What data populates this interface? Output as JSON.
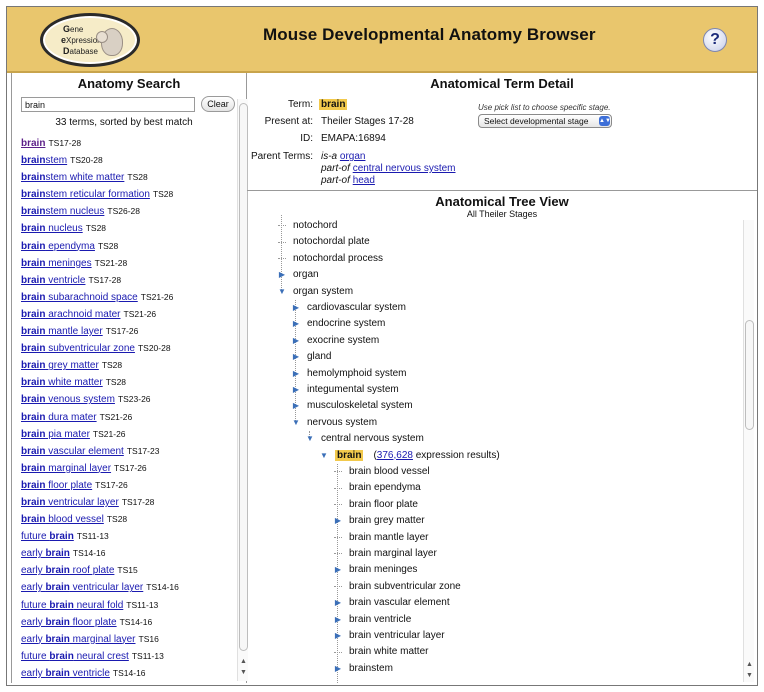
{
  "header": {
    "logo_lines": [
      "Gene",
      "eXpression",
      "Database"
    ],
    "title": "Mouse Developmental Anatomy Browser",
    "help_label": "?"
  },
  "search": {
    "title": "Anatomy Search",
    "query": "brain",
    "clear_label": "Clear",
    "count_text": "33 terms, sorted by best match",
    "results": [
      {
        "pre": "",
        "hl": "brain",
        "post": "",
        "ts": "TS17-28",
        "visited": true
      },
      {
        "pre": "",
        "hl": "brain",
        "post": "stem",
        "ts": "TS20-28"
      },
      {
        "pre": "",
        "hl": "brain",
        "post": "stem white matter",
        "ts": "TS28"
      },
      {
        "pre": "",
        "hl": "brain",
        "post": "stem reticular formation",
        "ts": "TS28"
      },
      {
        "pre": "",
        "hl": "brain",
        "post": "stem nucleus",
        "ts": "TS26-28"
      },
      {
        "pre": "",
        "hl": "brain",
        "post": " nucleus",
        "ts": "TS28"
      },
      {
        "pre": "",
        "hl": "brain",
        "post": " ependyma",
        "ts": "TS28"
      },
      {
        "pre": "",
        "hl": "brain",
        "post": " meninges",
        "ts": "TS21-28"
      },
      {
        "pre": "",
        "hl": "brain",
        "post": " ventricle",
        "ts": "TS17-28"
      },
      {
        "pre": "",
        "hl": "brain",
        "post": " subarachnoid space",
        "ts": "TS21-26"
      },
      {
        "pre": "",
        "hl": "brain",
        "post": " arachnoid mater",
        "ts": "TS21-26"
      },
      {
        "pre": "",
        "hl": "brain",
        "post": " mantle layer",
        "ts": "TS17-26"
      },
      {
        "pre": "",
        "hl": "brain",
        "post": " subventricular zone",
        "ts": "TS20-28"
      },
      {
        "pre": "",
        "hl": "brain",
        "post": " grey matter",
        "ts": "TS28"
      },
      {
        "pre": "",
        "hl": "brain",
        "post": " white matter",
        "ts": "TS28"
      },
      {
        "pre": "",
        "hl": "brain",
        "post": " venous system",
        "ts": "TS23-26"
      },
      {
        "pre": "",
        "hl": "brain",
        "post": " dura mater",
        "ts": "TS21-26"
      },
      {
        "pre": "",
        "hl": "brain",
        "post": " pia mater",
        "ts": "TS21-26"
      },
      {
        "pre": "",
        "hl": "brain",
        "post": " vascular element",
        "ts": "TS17-23"
      },
      {
        "pre": "",
        "hl": "brain",
        "post": " marginal layer",
        "ts": "TS17-26"
      },
      {
        "pre": "",
        "hl": "brain",
        "post": " floor plate",
        "ts": "TS17-26"
      },
      {
        "pre": "",
        "hl": "brain",
        "post": " ventricular layer",
        "ts": "TS17-28"
      },
      {
        "pre": "",
        "hl": "brain",
        "post": " blood vessel",
        "ts": "TS28"
      },
      {
        "pre": "future ",
        "hl": "brain",
        "post": "",
        "ts": "TS11-13"
      },
      {
        "pre": "early ",
        "hl": "brain",
        "post": "",
        "ts": "TS14-16"
      },
      {
        "pre": "early ",
        "hl": "brain",
        "post": " roof plate",
        "ts": "TS15"
      },
      {
        "pre": "early ",
        "hl": "brain",
        "post": " ventricular layer",
        "ts": "TS14-16"
      },
      {
        "pre": "future ",
        "hl": "brain",
        "post": " neural fold",
        "ts": "TS11-13"
      },
      {
        "pre": "early ",
        "hl": "brain",
        "post": " floor plate",
        "ts": "TS14-16"
      },
      {
        "pre": "early ",
        "hl": "brain",
        "post": " marginal layer",
        "ts": "TS16"
      },
      {
        "pre": "future ",
        "hl": "brain",
        "post": " neural crest",
        "ts": "TS11-13"
      },
      {
        "pre": "early ",
        "hl": "brain",
        "post": " ventricle",
        "ts": "TS14-16"
      }
    ]
  },
  "detail": {
    "title": "Anatomical Term Detail",
    "term_label": "Term:",
    "term_value": "brain",
    "present_label": "Present at:",
    "present_value": "Theiler Stages 17-28",
    "id_label": "ID:",
    "id_value": "EMAPA:16894",
    "parent_label": "Parent Terms:",
    "parents": [
      {
        "rel": "is-a",
        "term": "organ"
      },
      {
        "rel": "part-of",
        "term": "central nervous system"
      },
      {
        "rel": "part-of",
        "term": "head"
      }
    ],
    "pick_hint": "Use pick list to choose specific stage.",
    "stage_select": "Select developmental stage"
  },
  "tree": {
    "title": "Anatomical Tree View",
    "subtitle": "All Theiler Stages",
    "selected_count": "376,628",
    "selected_suffix": "expression results)",
    "selected_prefix": "(",
    "nodes": [
      {
        "label": "notochord",
        "level": 0,
        "toggle": "none"
      },
      {
        "label": "notochordal plate",
        "level": 0,
        "toggle": "none"
      },
      {
        "label": "notochordal process",
        "level": 0,
        "toggle": "none"
      },
      {
        "label": "organ",
        "level": 0,
        "toggle": "collapsed"
      },
      {
        "label": "organ system",
        "level": 0,
        "toggle": "expanded"
      },
      {
        "label": "cardiovascular system",
        "level": 1,
        "toggle": "collapsed"
      },
      {
        "label": "endocrine system",
        "level": 1,
        "toggle": "collapsed"
      },
      {
        "label": "exocrine system",
        "level": 1,
        "toggle": "collapsed"
      },
      {
        "label": "gland",
        "level": 1,
        "toggle": "collapsed"
      },
      {
        "label": "hemolymphoid system",
        "level": 1,
        "toggle": "collapsed"
      },
      {
        "label": "integumental system",
        "level": 1,
        "toggle": "collapsed"
      },
      {
        "label": "musculoskeletal system",
        "level": 1,
        "toggle": "collapsed"
      },
      {
        "label": "nervous system",
        "level": 1,
        "toggle": "expanded"
      },
      {
        "label": "central nervous system",
        "level": 2,
        "toggle": "expanded"
      },
      {
        "label": "brain",
        "level": 3,
        "toggle": "expanded",
        "selected": true
      },
      {
        "label": "brain blood vessel",
        "level": 4,
        "toggle": "none"
      },
      {
        "label": "brain ependyma",
        "level": 4,
        "toggle": "none"
      },
      {
        "label": "brain floor plate",
        "level": 4,
        "toggle": "none"
      },
      {
        "label": "brain grey matter",
        "level": 4,
        "toggle": "collapsed"
      },
      {
        "label": "brain mantle layer",
        "level": 4,
        "toggle": "none"
      },
      {
        "label": "brain marginal layer",
        "level": 4,
        "toggle": "none"
      },
      {
        "label": "brain meninges",
        "level": 4,
        "toggle": "collapsed"
      },
      {
        "label": "brain subventricular zone",
        "level": 4,
        "toggle": "none"
      },
      {
        "label": "brain vascular element",
        "level": 4,
        "toggle": "collapsed"
      },
      {
        "label": "brain ventricle",
        "level": 4,
        "toggle": "collapsed"
      },
      {
        "label": "brain ventricular layer",
        "level": 4,
        "toggle": "collapsed"
      },
      {
        "label": "brain white matter",
        "level": 4,
        "toggle": "none"
      },
      {
        "label": "brainstem",
        "level": 4,
        "toggle": "collapsed"
      }
    ]
  },
  "colors": {
    "header_bg": "#e9c66d",
    "highlight": "#f2c94c",
    "link": "#1a1ab0",
    "tree_toggle": "#3b6fb8"
  }
}
